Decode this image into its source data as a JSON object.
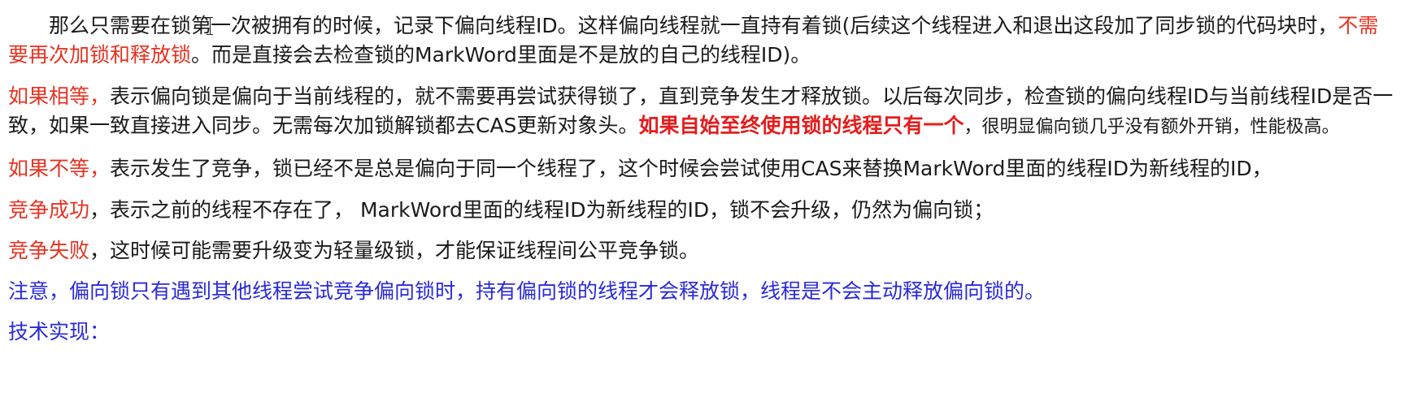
{
  "paragraphs": {
    "p1": {
      "a": "那么只需要在锁第",
      "b": "一次被拥有的时候，记录下偏向线程ID。这样偏向线程就一直持有着锁(后续这个线程进入和退出这段加了同步锁的代码块时，",
      "red": "不需要再次加锁和释放锁",
      "c": "。而是直接会去检查锁的MarkWord里面是不是放的自己的线程ID)。"
    },
    "p2": {
      "red": "如果相等，",
      "a": "表示偏向锁是偏向于当前线程的，就不需要再尝试获得锁了，直到竞争发生才释放锁。以后每次同步，检查锁的偏向线程ID与当前线程ID是否一致，如果一致直接进入同步。无需每次加锁解锁都去CAS更新对象头。",
      "bold_red": "如果自始至终使用锁的线程只有一个",
      "b": "，很明显偏向锁几乎没有额外开销，性能极高。"
    },
    "p3": {
      "red": "如果不等，",
      "a": "表示发生了竞争，锁已经不是总是偏向于同一个线程了，这个时候会尝试使用CAS来替换MarkWord里面的线程ID为新线程的ID，"
    },
    "p4": {
      "red": "竞争成功",
      "a": "，表示之前的线程不存在了， MarkWord里面的线程ID为新线程的ID，锁不会升级，仍然为偏向锁；"
    },
    "p5": {
      "red": "竞争失败",
      "a": "，这时候可能需要升级变为轻量级锁，才能保证线程间公平竞争锁。"
    },
    "p6": {
      "blue": "注意，偏向锁只有遇到其他线程尝试竞争偏向锁时，持有偏向锁的线程才会释放锁，线程是不会主动释放偏向锁的。"
    },
    "p7": {
      "blue": "技术实现："
    }
  },
  "colors": {
    "text": "#1a1a1a",
    "red": "#e53322",
    "blue": "#2a2ad8",
    "background": "#ffffff"
  },
  "icons": {
    "cursor": "text-cursor-icon"
  }
}
